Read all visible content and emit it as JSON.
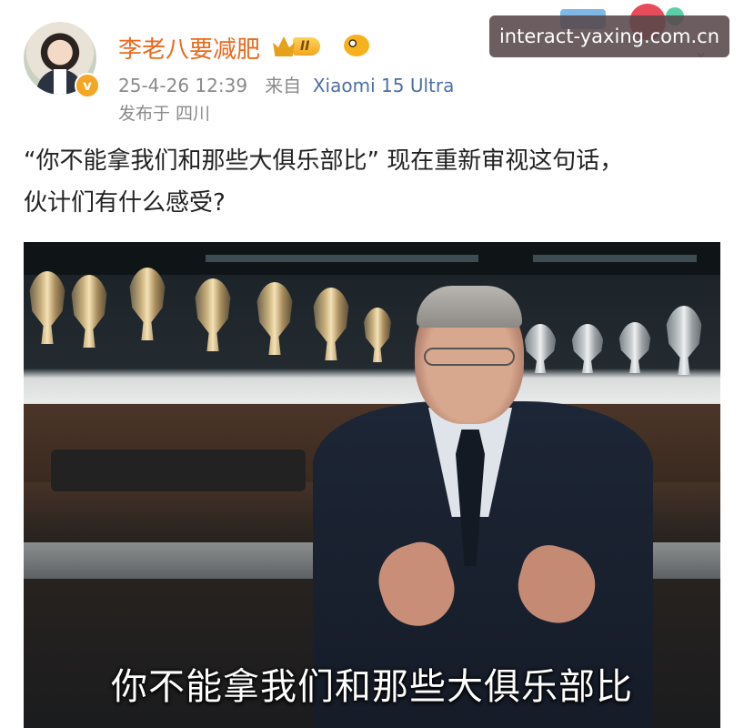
{
  "post": {
    "author": {
      "name": "李老八要减肥",
      "level_badge": "II",
      "verified_mark": "v"
    },
    "timestamp": "25-4-26 12:39",
    "source_prefix": "来自",
    "source_device": "Xiaomi 15 Ultra",
    "location": "发布于 四川",
    "text_line1": "“你不能拿我们和那些大俱乐部比” 现在重新审视这句话，",
    "text_line2": "伙计们有什么感受?",
    "image_subtitle": "你不能拿我们和那些大俱乐部比"
  },
  "watermark": "interact-yaxing.com.cn",
  "colors": {
    "username": "#ea6a1f",
    "meta": "#8a8a8a",
    "device": "#4d6fa8",
    "watermark_bg": "#58484a"
  },
  "icons": [
    "avatar",
    "verified-icon",
    "crown-icon",
    "fish-icon",
    "more-icon"
  ]
}
